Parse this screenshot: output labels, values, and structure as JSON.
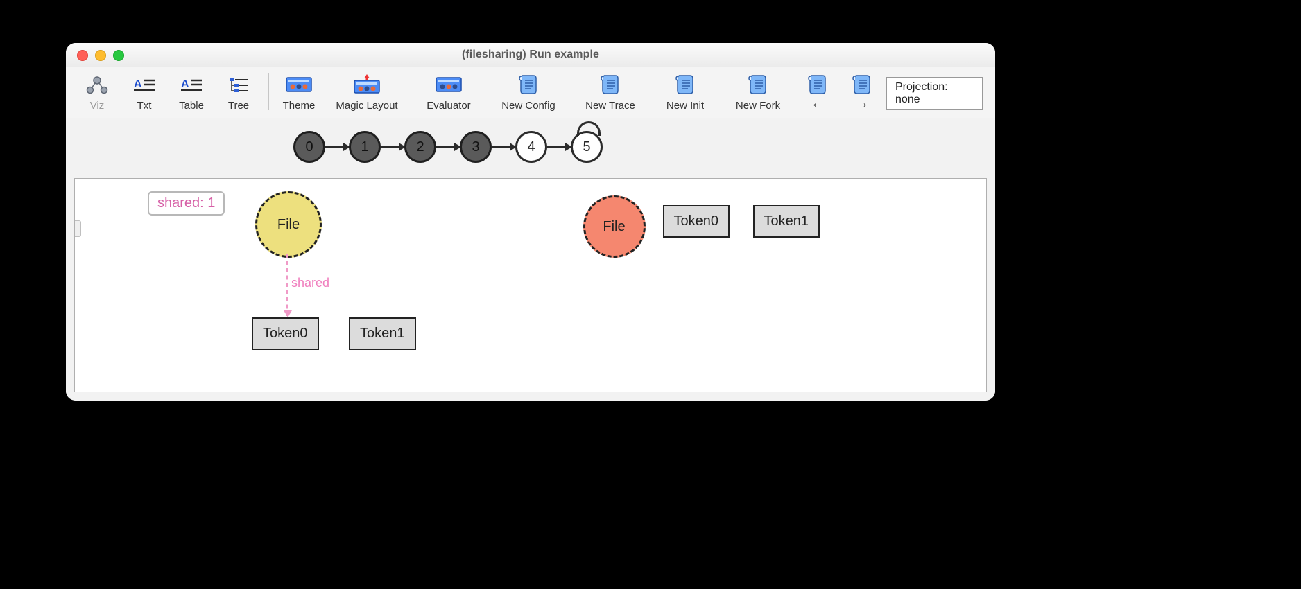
{
  "window": {
    "title": "(filesharing) Run example"
  },
  "toolbar": {
    "viz": "Viz",
    "txt": "Txt",
    "table": "Table",
    "tree": "Tree",
    "theme": "Theme",
    "magic_layout": "Magic Layout",
    "evaluator": "Evaluator",
    "new_config": "New Config",
    "new_trace": "New Trace",
    "new_init": "New Init",
    "new_fork": "New Fork",
    "prev": "←",
    "next": "→",
    "projection": "Projection: none"
  },
  "trace": {
    "steps": [
      "0",
      "1",
      "2",
      "3",
      "4",
      "5"
    ],
    "current_index": 4,
    "loop_index": 5
  },
  "left_pane": {
    "annotation": "shared: 1",
    "file_label": "File",
    "edge_label": "shared",
    "tokens": [
      "Token0",
      "Token1"
    ]
  },
  "right_pane": {
    "file_label": "File",
    "tokens": [
      "Token0",
      "Token1"
    ]
  }
}
